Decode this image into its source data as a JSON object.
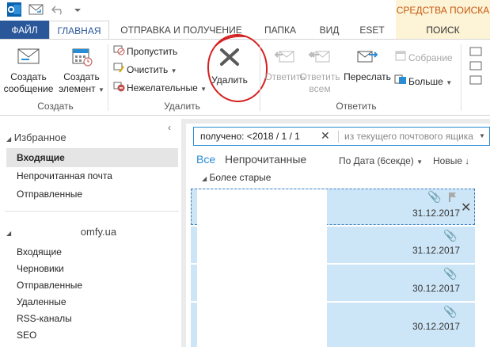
{
  "titlebar": {
    "outlook_icon": "outlook-icon",
    "send_receive_icon": "send-receive-all-icon",
    "undo_icon": "undo-icon",
    "customize_icon": "qat-customize-icon",
    "contextual_header": "СРЕДСТВА ПОИСКА"
  },
  "tabs": {
    "file": "ФАЙЛ",
    "home": "ГЛАВНАЯ",
    "send_receive": "ОТПРАВКА И ПОЛУЧЕНИЕ",
    "folder": "ПАПКА",
    "view": "ВИД",
    "eset": "ESET",
    "search": "ПОИСК"
  },
  "ribbon": {
    "new_message": {
      "line1": "Создать",
      "line2": "сообщение",
      "icon": "new-email-icon"
    },
    "new_items": {
      "line1": "Создать",
      "line2": "элемент",
      "icon": "new-items-icon"
    },
    "group_new": "Создать",
    "ignore": {
      "label": "Пропустить",
      "icon": "ignore-icon"
    },
    "clean_up": {
      "label": "Очистить",
      "icon": "clean-up-icon"
    },
    "junk": {
      "label": "Нежелательные",
      "icon": "junk-icon"
    },
    "delete": {
      "label": "Удалить",
      "icon": "delete-x-icon"
    },
    "group_delete": "Удалить",
    "reply": {
      "label": "Ответить",
      "icon": "reply-icon"
    },
    "reply_all": {
      "line1": "Ответить",
      "line2": "всем",
      "icon": "reply-all-icon"
    },
    "forward": {
      "label": "Переслать",
      "icon": "forward-icon"
    },
    "meeting": {
      "label": "Собрание",
      "icon": "meeting-icon"
    },
    "more": {
      "label": "Больше",
      "icon": "more-icon"
    },
    "group_respond": "Ответить",
    "highlight_color": "#d42020"
  },
  "nav": {
    "favorites": "Избранное",
    "inbox": "Входящие",
    "unread": "Непрочитанная почта",
    "sent": "Отправленные",
    "account_suffix": "omfy.ua",
    "acc_inbox": "Входящие",
    "acc_drafts": "Черновики",
    "acc_sent": "Отправленные",
    "acc_deleted": "Удаленные",
    "acc_rss": "RSS-каналы",
    "acc_seo": "SEO"
  },
  "search": {
    "query": "получено: <2018 / 1 / 1",
    "scope": "из текущего почтового ящика",
    "clear_icon": "clear-x-icon",
    "scope_dropdown_icon": "chevron-down-icon"
  },
  "filters": {
    "all": "Все",
    "unread": "Непрочитанные",
    "sort": "По Дата (6секде)",
    "order": "Новые"
  },
  "list": {
    "group_header": "Более старые",
    "messages": [
      {
        "date": "31.12.2017"
      },
      {
        "date": "31.12.2017"
      },
      {
        "date": "30.12.2017"
      },
      {
        "date": "30.12.2017"
      }
    ]
  },
  "colors": {
    "accent": "#2a579a",
    "selected_message": "#cde6f7",
    "search_tab": "#fdf3d6",
    "search_header_text": "#c55a11"
  }
}
